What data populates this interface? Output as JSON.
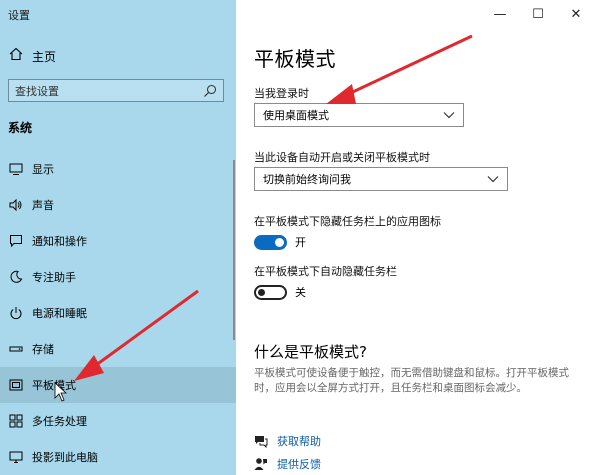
{
  "window": {
    "title": "设置",
    "controls": {
      "minimize": "—",
      "maximize": "☐",
      "close": "✕"
    }
  },
  "sidebar": {
    "home_label": "主页",
    "search_placeholder": "查找设置",
    "section_title": "系统",
    "items": [
      {
        "label": "显示",
        "icon": "display-icon"
      },
      {
        "label": "声音",
        "icon": "sound-icon"
      },
      {
        "label": "通知和操作",
        "icon": "notification-icon"
      },
      {
        "label": "专注助手",
        "icon": "focus-assist-icon"
      },
      {
        "label": "电源和睡眠",
        "icon": "power-icon"
      },
      {
        "label": "存储",
        "icon": "storage-icon"
      },
      {
        "label": "平板模式",
        "icon": "tablet-mode-icon",
        "active": true
      },
      {
        "label": "多任务处理",
        "icon": "multitasking-icon"
      },
      {
        "label": "投影到此电脑",
        "icon": "project-icon"
      }
    ]
  },
  "main": {
    "title": "平板模式",
    "signin_label": "当我登录时",
    "signin_value": "使用桌面模式",
    "auto_switch_label": "当此设备自动开启或关闭平板模式时",
    "auto_switch_value": "切换前始终询问我",
    "hide_icons_label": "在平板模式下隐藏任务栏上的应用图标",
    "hide_icons_state": "开",
    "hide_icons_on": true,
    "autohide_label": "在平板模式下自动隐藏任务栏",
    "autohide_state": "关",
    "autohide_on": false,
    "what_is_title": "什么是平板模式?",
    "what_is_desc": "平板模式可使设备便于触控，而无需借助键盘和鼠标。打开平板模式时，应用会以全屏方式打开，且任务栏和桌面图标会减少。",
    "get_help": "获取帮助",
    "feedback": "提供反馈"
  },
  "colors": {
    "sidebar_bg": "#a9d8ec",
    "active_item_bg": "#97c4d6",
    "accent": "#0a6cc1",
    "arrow": "#e0282f"
  }
}
